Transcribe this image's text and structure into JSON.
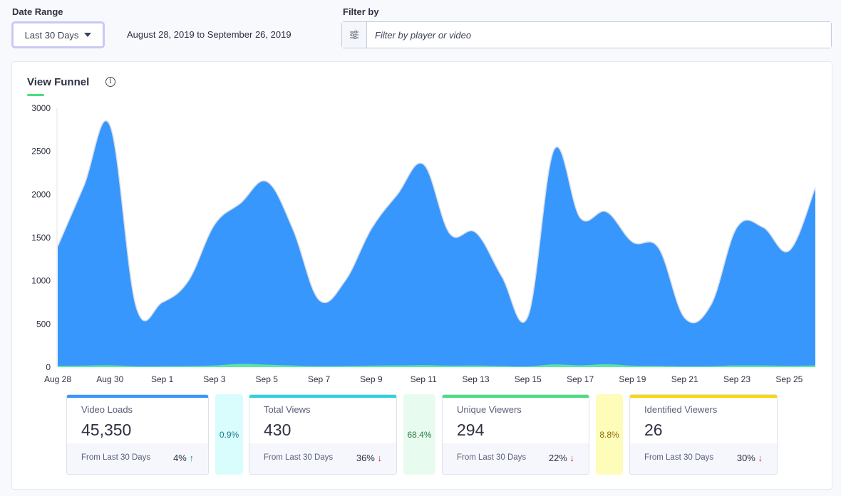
{
  "date_range": {
    "label": "Date Range",
    "selected": "Last 30 Days",
    "range_text": "August 28, 2019 to September 26, 2019"
  },
  "filter": {
    "label": "Filter by",
    "placeholder": "Filter by player or video",
    "icon": "sliders-icon"
  },
  "panel": {
    "title": "View Funnel",
    "info_icon": "info-icon"
  },
  "chart_data": {
    "type": "area",
    "ylim": [
      0,
      3000
    ],
    "yticks": [
      0,
      500,
      1000,
      1500,
      2000,
      2500,
      3000
    ],
    "x": [
      "Aug 28",
      "Aug 29",
      "Aug 30",
      "Aug 31",
      "Sep 1",
      "Sep 2",
      "Sep 3",
      "Sep 4",
      "Sep 5",
      "Sep 6",
      "Sep 7",
      "Sep 8",
      "Sep 9",
      "Sep 10",
      "Sep 11",
      "Sep 12",
      "Sep 13",
      "Sep 14",
      "Sep 15",
      "Sep 16",
      "Sep 17",
      "Sep 18",
      "Sep 19",
      "Sep 20",
      "Sep 21",
      "Sep 22",
      "Sep 23",
      "Sep 24",
      "Sep 25",
      "Sep 26"
    ],
    "xticks": [
      "Aug 28",
      "Aug 30",
      "Sep 1",
      "Sep 3",
      "Sep 5",
      "Sep 7",
      "Sep 9",
      "Sep 11",
      "Sep 13",
      "Sep 15",
      "Sep 17",
      "Sep 19",
      "Sep 21",
      "Sep 23",
      "Sep 25"
    ],
    "series": [
      {
        "color": "#3797fd",
        "values": [
          1400,
          2100,
          2800,
          700,
          750,
          1000,
          1650,
          1900,
          2150,
          1600,
          780,
          1000,
          1600,
          2000,
          2350,
          1550,
          1560,
          1050,
          590,
          2520,
          1730,
          1800,
          1450,
          1380,
          570,
          720,
          1620,
          1620,
          1350,
          2080
        ]
      },
      {
        "color": "#5ee6a0",
        "values": [
          12,
          14,
          18,
          8,
          8,
          10,
          16,
          35,
          25,
          15,
          8,
          10,
          14,
          16,
          20,
          14,
          15,
          10,
          6,
          28,
          18,
          30,
          14,
          12,
          6,
          8,
          16,
          16,
          12,
          16
        ]
      }
    ]
  },
  "stats": [
    {
      "name": "Video Loads",
      "value": "45,350",
      "foot": "From Last 30 Days",
      "change": "4%",
      "dir": "up",
      "color": "#3797fd"
    },
    {
      "name": "Total Views",
      "value": "430",
      "foot": "From Last 30 Days",
      "change": "36%",
      "dir": "down",
      "color": "#2dd4e0"
    },
    {
      "name": "Unique Viewers",
      "value": "294",
      "foot": "From Last 30 Days",
      "change": "22%",
      "dir": "down",
      "color": "#4ade80"
    },
    {
      "name": "Identified Viewers",
      "value": "26",
      "foot": "From Last 30 Days",
      "change": "30%",
      "dir": "down",
      "color": "#fad700"
    }
  ],
  "conversions": [
    {
      "value": "0.9%",
      "bg": "#d9fcfd",
      "fg": "#1a7f8a"
    },
    {
      "value": "68.4%",
      "bg": "#e7fcee",
      "fg": "#2f7a4a"
    },
    {
      "value": "8.8%",
      "bg": "#fdfcb8",
      "fg": "#8a6d10"
    }
  ]
}
